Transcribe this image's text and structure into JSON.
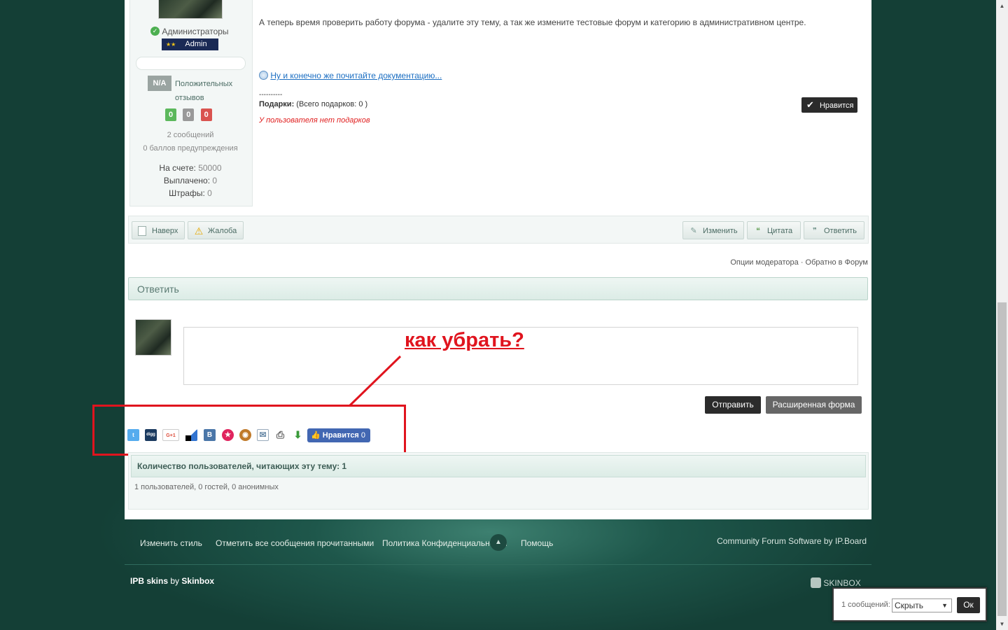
{
  "user_panel": {
    "group": "Администраторы",
    "rank_stars": "★★",
    "rank": "Admin",
    "rep_badge": "N/A",
    "rep_label_1": "Положительных",
    "rep_label_2": "отзывов",
    "rep_counts": [
      "0",
      "0",
      "0"
    ],
    "posts": "2 сообщений",
    "warnings": "0 баллов предупреждения",
    "account_label": "На счете:",
    "account_value": "50000",
    "paid_label": "Выплачено:",
    "paid_value": "0",
    "fines_label": "Штрафы:",
    "fines_value": "0"
  },
  "post": {
    "text": "А теперь время проверить работу форума - удалите эту тему, а так же измените тестовые форум и категорию в административном центре.",
    "doc_link": "Ну и конечно же почитайте документацию...",
    "separator": "----------",
    "gifts_label": "Подарки:",
    "gifts_count": "(Всего подарков: 0 )",
    "no_gifts": "У пользователя нет подарков",
    "like_button": "Нравится"
  },
  "controls": {
    "top": "Наверх",
    "report": "Жалоба",
    "edit": "Изменить",
    "quote": "Цитата",
    "reply": "Ответить"
  },
  "moderator": {
    "options": "Опции модератора",
    "dot": "·",
    "back": "Обратно в Форум"
  },
  "reply_box": {
    "title": "Ответить",
    "annotation": "как убрать?",
    "send": "Отправить",
    "advanced": "Расширенная форма"
  },
  "share": {
    "twitter": "t",
    "digg": "digg",
    "gplus": "G+1",
    "vk": "B",
    "like_label": "Нравится",
    "like_count": "0"
  },
  "readers": {
    "title": "Количество пользователей, читающих эту тему: 1",
    "detail": "1 пользователей, 0 гостей, 0 анонимных"
  },
  "footer": {
    "change_style": "Изменить стиль",
    "mark_read": "Отметить все сообщения прочитанными",
    "privacy": "Политика Конфиденциальности",
    "help": "Помощь",
    "credits": "Community Forum Software by IP.Board",
    "ipb_skins": "IPB skins",
    "by": "by",
    "skinbox": "Skinbox",
    "skinbox_logo": "SKINBOX"
  },
  "moderation_bar": {
    "label": "1 сообщений:",
    "selected": "Скрыть",
    "ok": "Ок"
  },
  "colors": {
    "accent_link": "#1b6ec2",
    "annotation_red": "#e0141e",
    "dark_button": "#2b2b2b",
    "header_green": "#e4f1ec"
  }
}
